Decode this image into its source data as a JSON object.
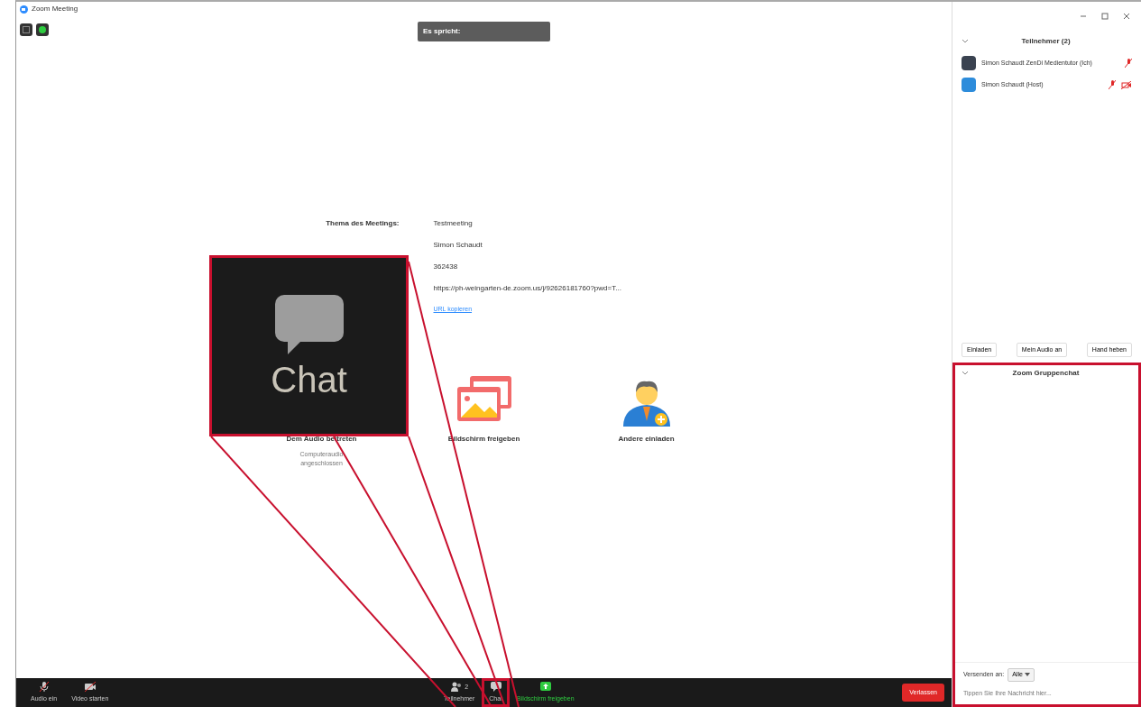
{
  "window": {
    "title": "Zoom Meeting"
  },
  "speaker_popup": "Es spricht:",
  "meeting_info": {
    "topic_label": "Thema des Meetings:",
    "values": [
      "Testmeeting",
      "Simon Schaudt",
      "362438",
      "https://ph-weingarten-de.zoom.us/j/92626181760?pwd=T..."
    ],
    "copy_link": "URL kopieren"
  },
  "actions": [
    {
      "kind": "audio",
      "label": "Dem Audio beitreten",
      "note": "Computeraudio angeschlossen"
    },
    {
      "kind": "share",
      "label": "Bildschirm freigeben"
    },
    {
      "kind": "invite",
      "label": "Andere einladen"
    }
  ],
  "participants": {
    "title": "Teilnehmer (2)",
    "items": [
      {
        "name": "Simon Schaudt ZenDi Medientutor (Ich)",
        "color": "#3a4250",
        "mic_muted": true,
        "video_off": false
      },
      {
        "name": "Simon Schaudt (Host)",
        "color": "#2d8cdb",
        "mic_muted": true,
        "video_off": true
      }
    ],
    "buttons": [
      "Einladen",
      "Mein Audio an",
      "Hand heben"
    ]
  },
  "chat": {
    "title": "Zoom Gruppenchat",
    "annotated": true,
    "send_to_label": "Versenden an:",
    "recipient": "Alle",
    "placeholder": "Tippen Sie Ihre Nachricht hier..."
  },
  "toolbar": {
    "items": [
      {
        "kind": "audio",
        "label": "Audio ein",
        "highlighted": false,
        "annotated": false
      },
      {
        "kind": "video",
        "label": "Video starten",
        "highlighted": false,
        "annotated": false
      },
      {
        "kind": "participants",
        "label": "Teilnehmer",
        "count": "2",
        "highlighted": false,
        "annotated": false
      },
      {
        "kind": "chat",
        "label": "Chat",
        "highlighted": false,
        "annotated": true
      },
      {
        "kind": "share",
        "label": "Bildschirm freigeben",
        "highlighted": true,
        "annotated": false
      }
    ],
    "leave": "Verlassen"
  },
  "callout": {
    "label": "Chat"
  }
}
